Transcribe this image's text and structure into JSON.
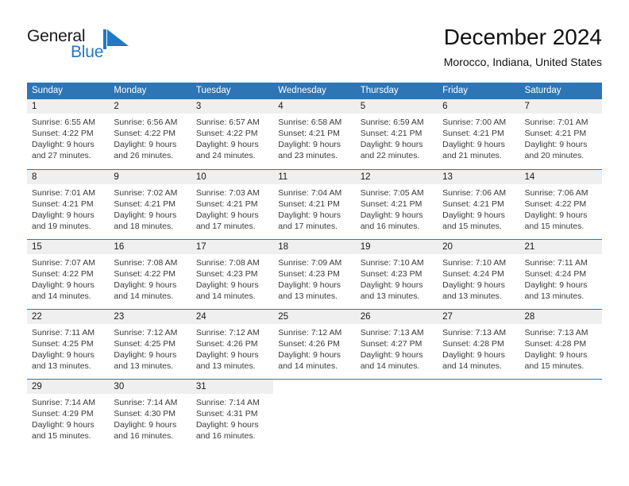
{
  "brand": {
    "name_part1": "General",
    "name_part2": "Blue",
    "mark": "triangle-flag-icon",
    "accent_color": "#2079c5"
  },
  "header": {
    "title": "December 2024",
    "subtitle": "Morocco, Indiana, United States"
  },
  "theme": {
    "header_blue": "#2e75b6",
    "day_strip_gray": "#efefef"
  },
  "weekdays": [
    "Sunday",
    "Monday",
    "Tuesday",
    "Wednesday",
    "Thursday",
    "Friday",
    "Saturday"
  ],
  "weeks": [
    {
      "days": [
        {
          "date": "1",
          "sunrise": "Sunrise: 6:55 AM",
          "sunset": "Sunset: 4:22 PM",
          "daylight_line1": "Daylight: 9 hours",
          "daylight_line2": "and 27 minutes."
        },
        {
          "date": "2",
          "sunrise": "Sunrise: 6:56 AM",
          "sunset": "Sunset: 4:22 PM",
          "daylight_line1": "Daylight: 9 hours",
          "daylight_line2": "and 26 minutes."
        },
        {
          "date": "3",
          "sunrise": "Sunrise: 6:57 AM",
          "sunset": "Sunset: 4:22 PM",
          "daylight_line1": "Daylight: 9 hours",
          "daylight_line2": "and 24 minutes."
        },
        {
          "date": "4",
          "sunrise": "Sunrise: 6:58 AM",
          "sunset": "Sunset: 4:21 PM",
          "daylight_line1": "Daylight: 9 hours",
          "daylight_line2": "and 23 minutes."
        },
        {
          "date": "5",
          "sunrise": "Sunrise: 6:59 AM",
          "sunset": "Sunset: 4:21 PM",
          "daylight_line1": "Daylight: 9 hours",
          "daylight_line2": "and 22 minutes."
        },
        {
          "date": "6",
          "sunrise": "Sunrise: 7:00 AM",
          "sunset": "Sunset: 4:21 PM",
          "daylight_line1": "Daylight: 9 hours",
          "daylight_line2": "and 21 minutes."
        },
        {
          "date": "7",
          "sunrise": "Sunrise: 7:01 AM",
          "sunset": "Sunset: 4:21 PM",
          "daylight_line1": "Daylight: 9 hours",
          "daylight_line2": "and 20 minutes."
        }
      ]
    },
    {
      "days": [
        {
          "date": "8",
          "sunrise": "Sunrise: 7:01 AM",
          "sunset": "Sunset: 4:21 PM",
          "daylight_line1": "Daylight: 9 hours",
          "daylight_line2": "and 19 minutes."
        },
        {
          "date": "9",
          "sunrise": "Sunrise: 7:02 AM",
          "sunset": "Sunset: 4:21 PM",
          "daylight_line1": "Daylight: 9 hours",
          "daylight_line2": "and 18 minutes."
        },
        {
          "date": "10",
          "sunrise": "Sunrise: 7:03 AM",
          "sunset": "Sunset: 4:21 PM",
          "daylight_line1": "Daylight: 9 hours",
          "daylight_line2": "and 17 minutes."
        },
        {
          "date": "11",
          "sunrise": "Sunrise: 7:04 AM",
          "sunset": "Sunset: 4:21 PM",
          "daylight_line1": "Daylight: 9 hours",
          "daylight_line2": "and 17 minutes."
        },
        {
          "date": "12",
          "sunrise": "Sunrise: 7:05 AM",
          "sunset": "Sunset: 4:21 PM",
          "daylight_line1": "Daylight: 9 hours",
          "daylight_line2": "and 16 minutes."
        },
        {
          "date": "13",
          "sunrise": "Sunrise: 7:06 AM",
          "sunset": "Sunset: 4:21 PM",
          "daylight_line1": "Daylight: 9 hours",
          "daylight_line2": "and 15 minutes."
        },
        {
          "date": "14",
          "sunrise": "Sunrise: 7:06 AM",
          "sunset": "Sunset: 4:22 PM",
          "daylight_line1": "Daylight: 9 hours",
          "daylight_line2": "and 15 minutes."
        }
      ]
    },
    {
      "days": [
        {
          "date": "15",
          "sunrise": "Sunrise: 7:07 AM",
          "sunset": "Sunset: 4:22 PM",
          "daylight_line1": "Daylight: 9 hours",
          "daylight_line2": "and 14 minutes."
        },
        {
          "date": "16",
          "sunrise": "Sunrise: 7:08 AM",
          "sunset": "Sunset: 4:22 PM",
          "daylight_line1": "Daylight: 9 hours",
          "daylight_line2": "and 14 minutes."
        },
        {
          "date": "17",
          "sunrise": "Sunrise: 7:08 AM",
          "sunset": "Sunset: 4:23 PM",
          "daylight_line1": "Daylight: 9 hours",
          "daylight_line2": "and 14 minutes."
        },
        {
          "date": "18",
          "sunrise": "Sunrise: 7:09 AM",
          "sunset": "Sunset: 4:23 PM",
          "daylight_line1": "Daylight: 9 hours",
          "daylight_line2": "and 13 minutes."
        },
        {
          "date": "19",
          "sunrise": "Sunrise: 7:10 AM",
          "sunset": "Sunset: 4:23 PM",
          "daylight_line1": "Daylight: 9 hours",
          "daylight_line2": "and 13 minutes."
        },
        {
          "date": "20",
          "sunrise": "Sunrise: 7:10 AM",
          "sunset": "Sunset: 4:24 PM",
          "daylight_line1": "Daylight: 9 hours",
          "daylight_line2": "and 13 minutes."
        },
        {
          "date": "21",
          "sunrise": "Sunrise: 7:11 AM",
          "sunset": "Sunset: 4:24 PM",
          "daylight_line1": "Daylight: 9 hours",
          "daylight_line2": "and 13 minutes."
        }
      ]
    },
    {
      "days": [
        {
          "date": "22",
          "sunrise": "Sunrise: 7:11 AM",
          "sunset": "Sunset: 4:25 PM",
          "daylight_line1": "Daylight: 9 hours",
          "daylight_line2": "and 13 minutes."
        },
        {
          "date": "23",
          "sunrise": "Sunrise: 7:12 AM",
          "sunset": "Sunset: 4:25 PM",
          "daylight_line1": "Daylight: 9 hours",
          "daylight_line2": "and 13 minutes."
        },
        {
          "date": "24",
          "sunrise": "Sunrise: 7:12 AM",
          "sunset": "Sunset: 4:26 PM",
          "daylight_line1": "Daylight: 9 hours",
          "daylight_line2": "and 13 minutes."
        },
        {
          "date": "25",
          "sunrise": "Sunrise: 7:12 AM",
          "sunset": "Sunset: 4:26 PM",
          "daylight_line1": "Daylight: 9 hours",
          "daylight_line2": "and 14 minutes."
        },
        {
          "date": "26",
          "sunrise": "Sunrise: 7:13 AM",
          "sunset": "Sunset: 4:27 PM",
          "daylight_line1": "Daylight: 9 hours",
          "daylight_line2": "and 14 minutes."
        },
        {
          "date": "27",
          "sunrise": "Sunrise: 7:13 AM",
          "sunset": "Sunset: 4:28 PM",
          "daylight_line1": "Daylight: 9 hours",
          "daylight_line2": "and 14 minutes."
        },
        {
          "date": "28",
          "sunrise": "Sunrise: 7:13 AM",
          "sunset": "Sunset: 4:28 PM",
          "daylight_line1": "Daylight: 9 hours",
          "daylight_line2": "and 15 minutes."
        }
      ]
    },
    {
      "days": [
        {
          "date": "29",
          "sunrise": "Sunrise: 7:14 AM",
          "sunset": "Sunset: 4:29 PM",
          "daylight_line1": "Daylight: 9 hours",
          "daylight_line2": "and 15 minutes."
        },
        {
          "date": "30",
          "sunrise": "Sunrise: 7:14 AM",
          "sunset": "Sunset: 4:30 PM",
          "daylight_line1": "Daylight: 9 hours",
          "daylight_line2": "and 16 minutes."
        },
        {
          "date": "31",
          "sunrise": "Sunrise: 7:14 AM",
          "sunset": "Sunset: 4:31 PM",
          "daylight_line1": "Daylight: 9 hours",
          "daylight_line2": "and 16 minutes."
        },
        {
          "date": "",
          "sunrise": "",
          "sunset": "",
          "daylight_line1": "",
          "daylight_line2": ""
        },
        {
          "date": "",
          "sunrise": "",
          "sunset": "",
          "daylight_line1": "",
          "daylight_line2": ""
        },
        {
          "date": "",
          "sunrise": "",
          "sunset": "",
          "daylight_line1": "",
          "daylight_line2": ""
        },
        {
          "date": "",
          "sunrise": "",
          "sunset": "",
          "daylight_line1": "",
          "daylight_line2": ""
        }
      ]
    }
  ]
}
